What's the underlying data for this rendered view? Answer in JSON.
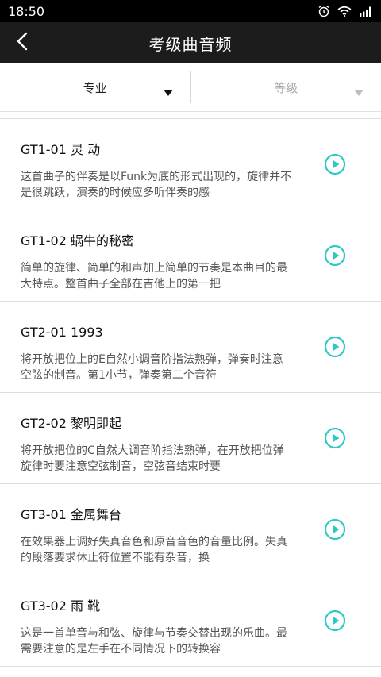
{
  "status_bar": {
    "time": "18:50",
    "icons": [
      "alarm-icon",
      "wifi-icon",
      "signal-icon",
      "battery-icon"
    ]
  },
  "header": {
    "title": "考级曲音频",
    "back_icon": "chevron-left-icon"
  },
  "filters": [
    {
      "label": "专业",
      "enabled": true
    },
    {
      "label": "等级",
      "enabled": false
    }
  ],
  "tracks": [
    {
      "title": "GT1-01 灵 动",
      "description": "这首曲子的伴奏是以Funk为底的形式出现的，旋律并不是很跳跃，演奏的时候应多听伴奏的感"
    },
    {
      "title": "GT1-02 蜗牛的秘密",
      "description": "简单的旋律、简单的和声加上简单的节奏是本曲目的最大特点。整首曲子全部在吉他上的第一把"
    },
    {
      "title": "GT2-01 1993",
      "description": "将开放把位上的E自然小调音阶指法熟弹，弹奏时注意空弦的制音。第1小节，弹奏第二个音符"
    },
    {
      "title": "GT2-02 黎明即起",
      "description": "将开放把位的C自然大调音阶指法熟弹，在开放把位弹旋律时要注意空弦制音，空弦音结束时要"
    },
    {
      "title": "GT3-01 金属舞台",
      "description": "在效果器上调好失真音色和原音音色的音量比例。失真的段落要求休止符位置不能有杂音，换"
    },
    {
      "title": "GT3-02 雨 靴",
      "description": "这是一首单音与和弦、旋律与节奏交替出现的乐曲。最需要注意的是左手在不同情况下的转换容"
    }
  ],
  "colors": {
    "status_bar_bg": "#000000",
    "app_bar_bg": "#1c1c1c",
    "accent_teal": "#2ec9c4"
  }
}
